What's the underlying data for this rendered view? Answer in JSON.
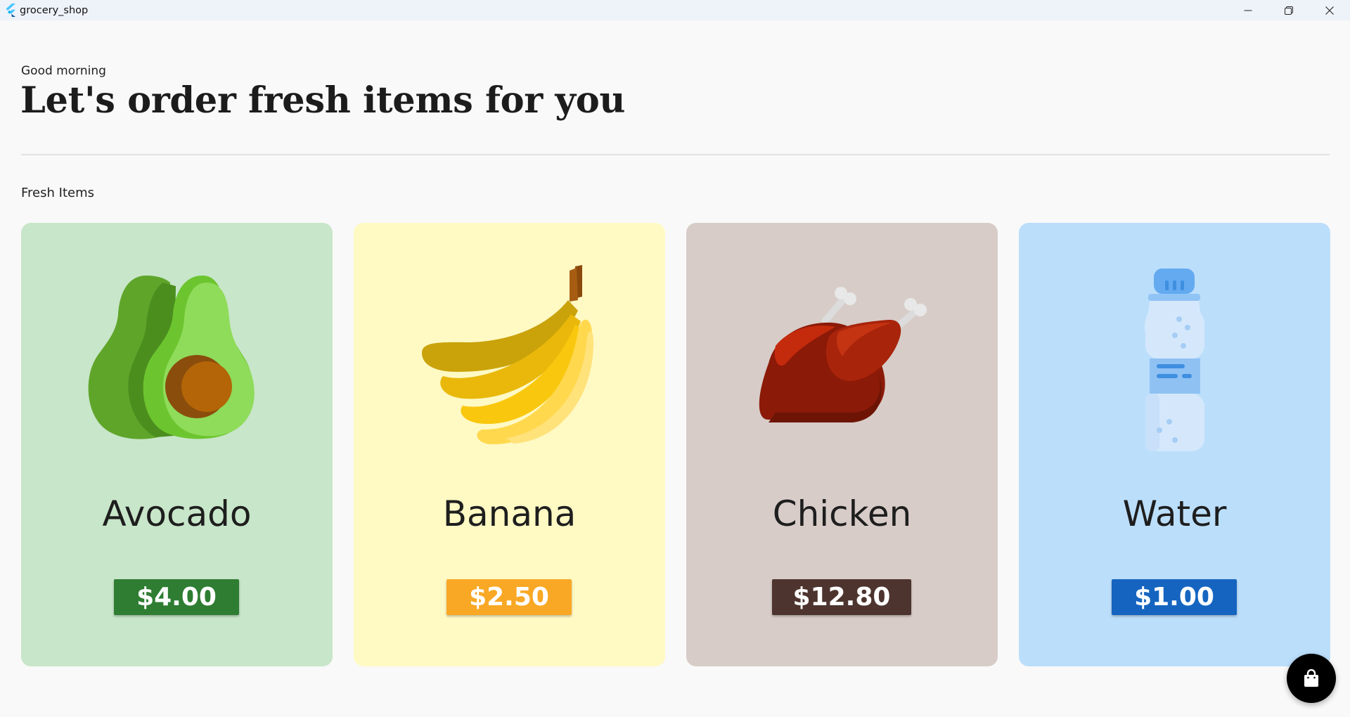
{
  "window": {
    "title": "grocery_shop",
    "controls": [
      "minimize-icon",
      "restore-icon",
      "close-icon"
    ]
  },
  "header": {
    "greeting": "Good morning",
    "headline": "Let's order fresh items for you"
  },
  "section": {
    "label": "Fresh Items"
  },
  "items": [
    {
      "name": "Avocado",
      "price": "$4.00",
      "icon": "avocado-icon",
      "card_color": "#c8e6c9",
      "price_color": "#2e7d32"
    },
    {
      "name": "Banana",
      "price": "$2.50",
      "icon": "banana-icon",
      "card_color": "#fff9c4",
      "price_color": "#f9a825"
    },
    {
      "name": "Chicken",
      "price": "$12.80",
      "icon": "chicken-icon",
      "card_color": "#d7ccc8",
      "price_color": "#4e342e"
    },
    {
      "name": "Water",
      "price": "$1.00",
      "icon": "water-bottle-icon",
      "card_color": "#bbdefb",
      "price_color": "#1565c0"
    }
  ],
  "cart": {
    "icon": "shopping-bag-icon",
    "color": "#000000"
  }
}
